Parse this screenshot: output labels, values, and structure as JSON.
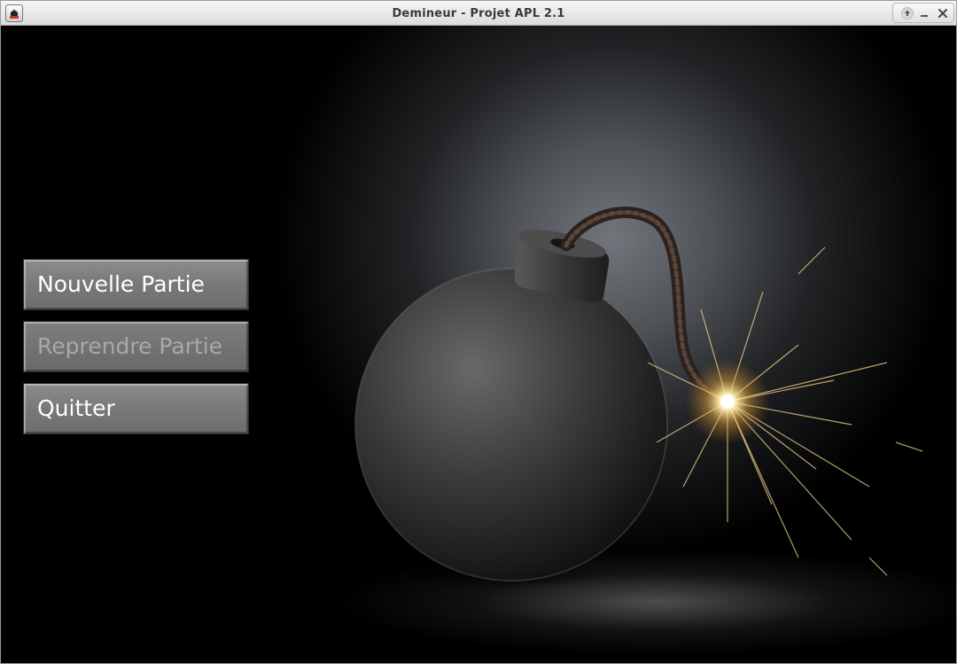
{
  "window": {
    "title": "Demineur - Projet APL 2.1"
  },
  "icons": {
    "app": "mine-app-icon",
    "maximize": "arrow-up-icon",
    "minimize": "minimize-icon",
    "close": "close-icon"
  },
  "menu": {
    "new_game_label": "Nouvelle Partie",
    "resume_game_label": "Reprendre Partie",
    "quit_label": "Quitter"
  },
  "colors": {
    "button_face": "#7a7a7a",
    "button_text": "#ffffff",
    "button_text_disabled": "#a8a8a8",
    "background": "#000000"
  }
}
